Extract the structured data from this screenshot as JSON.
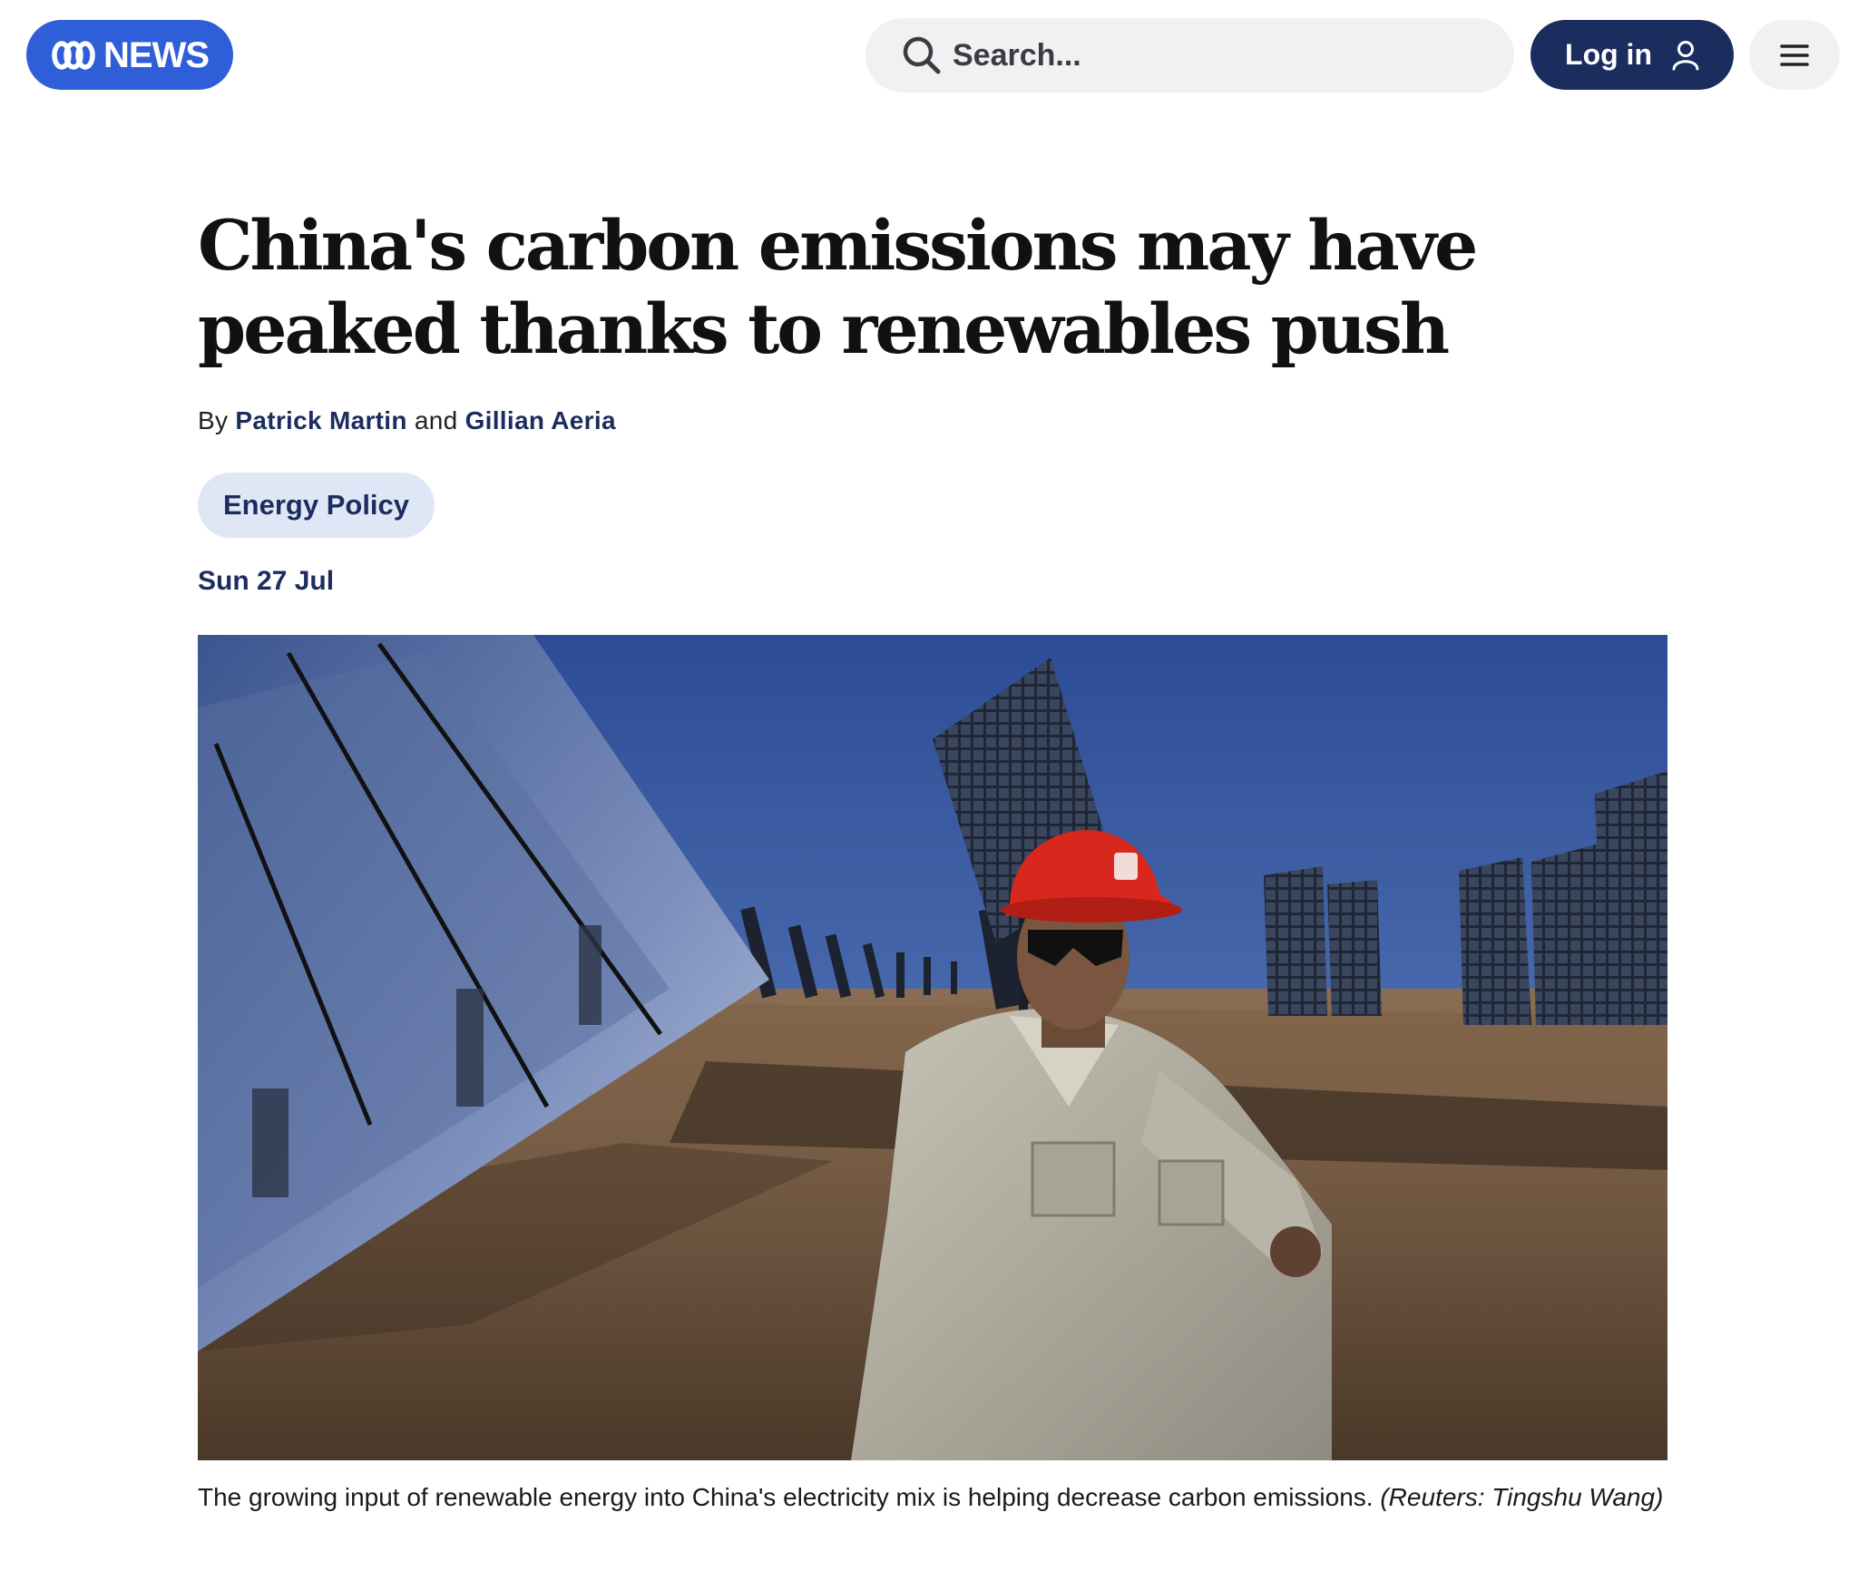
{
  "header": {
    "logo_text": "NEWS",
    "search": {
      "placeholder": "Search..."
    },
    "login_label": "Log in",
    "icons": {
      "search": "magnifier-icon",
      "login": "user-icon",
      "menu": "hamburger-menu-icon"
    },
    "colors": {
      "brand": "#2f5ed9",
      "navy": "#1b2d5e",
      "pill_bg": "#f0f1f3"
    }
  },
  "article": {
    "headline": "China's carbon emissions may have peaked thanks to renewables push",
    "byline": {
      "prefix": "By",
      "authors": [
        "Patrick Martin",
        "Gillian Aeria"
      ],
      "joiner": "and"
    },
    "topic_tag": "Energy Policy",
    "date": "Sun 27 Jul",
    "image": {
      "caption": "The growing input of renewable energy into China's electricity mix is helping decrease carbon emissions.",
      "credit": "(Reuters: Tingshu Wang)"
    }
  }
}
